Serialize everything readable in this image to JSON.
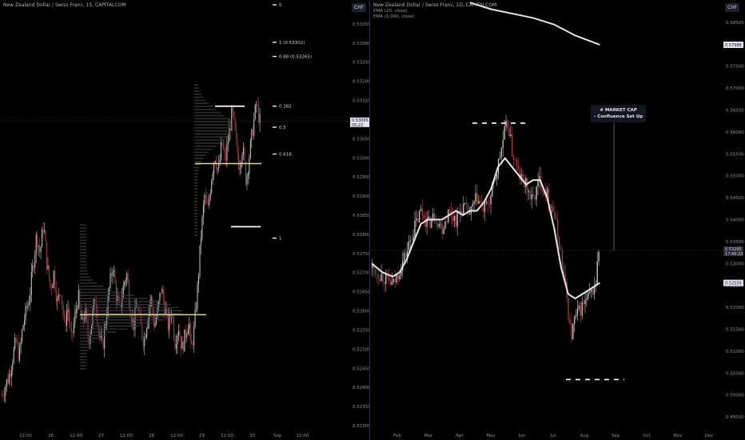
{
  "left": {
    "title": "New Zealand Dollar / Swiss Franc, 15, CAPITALCOM",
    "currency_button": "CHF",
    "price_tag": "0.53095",
    "price_tag_sub": "05:22",
    "fib_levels": [
      {
        "label": "0",
        "value": 0.534
      },
      {
        "label": "1 (0.53302)",
        "value": 0.53302
      },
      {
        "label": "0.88 (0.53265)",
        "value": 0.53265
      },
      {
        "label": "0.382",
        "value": 0.53135
      },
      {
        "label": "0.5",
        "value": 0.5308
      },
      {
        "label": "0.618",
        "value": 0.5301
      },
      {
        "label": "1",
        "value": 0.5279
      }
    ],
    "chart_data": {
      "type": "candlestick",
      "xlabel": "",
      "ylabel": "",
      "ylim": [
        0.523,
        0.534
      ],
      "y_ticks": [
        "0.53350",
        "0.53300",
        "0.53250",
        "0.53200",
        "0.53150",
        "0.53100",
        "0.53050",
        "0.53000",
        "0.52950",
        "0.52900",
        "0.52850",
        "0.52800",
        "0.52750",
        "0.52700",
        "0.52650",
        "0.52600",
        "0.52550",
        "0.52500",
        "0.52450",
        "0.52400",
        "0.52350",
        "0.52300"
      ],
      "x_ticks": [
        "12:00",
        "26",
        "12:00",
        "27",
        "12:00",
        "28",
        "12:00",
        "29",
        "12:00",
        "30",
        "Sep",
        "12:00"
      ],
      "last_price": 0.53095,
      "close_path": [
        [
          0.0,
          0.5238
        ],
        [
          0.02,
          0.5243
        ],
        [
          0.04,
          0.5252
        ],
        [
          0.05,
          0.5248
        ],
        [
          0.06,
          0.5256
        ],
        [
          0.08,
          0.5264
        ],
        [
          0.09,
          0.5272
        ],
        [
          0.1,
          0.528
        ],
        [
          0.11,
          0.5275
        ],
        [
          0.12,
          0.5283
        ],
        [
          0.13,
          0.5272
        ],
        [
          0.14,
          0.5266
        ],
        [
          0.15,
          0.527
        ],
        [
          0.16,
          0.5262
        ],
        [
          0.17,
          0.5266
        ],
        [
          0.18,
          0.5256
        ],
        [
          0.19,
          0.5261
        ],
        [
          0.2,
          0.5252
        ],
        [
          0.21,
          0.5258
        ],
        [
          0.22,
          0.5264
        ],
        [
          0.23,
          0.5256
        ],
        [
          0.24,
          0.526
        ],
        [
          0.25,
          0.5252
        ],
        [
          0.26,
          0.5258
        ],
        [
          0.27,
          0.5264
        ],
        [
          0.28,
          0.5254
        ],
        [
          0.29,
          0.525
        ],
        [
          0.3,
          0.5258
        ],
        [
          0.31,
          0.5266
        ],
        [
          0.32,
          0.5272
        ],
        [
          0.33,
          0.5264
        ],
        [
          0.34,
          0.526
        ],
        [
          0.35,
          0.5266
        ],
        [
          0.36,
          0.527
        ],
        [
          0.37,
          0.5261
        ],
        [
          0.38,
          0.5256
        ],
        [
          0.39,
          0.5262
        ],
        [
          0.4,
          0.5256
        ],
        [
          0.41,
          0.5252
        ],
        [
          0.42,
          0.5258
        ],
        [
          0.43,
          0.5264
        ],
        [
          0.44,
          0.5256
        ],
        [
          0.45,
          0.526
        ],
        [
          0.46,
          0.5266
        ],
        [
          0.47,
          0.5261
        ],
        [
          0.48,
          0.5256
        ],
        [
          0.49,
          0.526
        ],
        [
          0.5,
          0.5252
        ],
        [
          0.51,
          0.5256
        ],
        [
          0.52,
          0.525
        ],
        [
          0.53,
          0.5254
        ],
        [
          0.54,
          0.5258
        ],
        [
          0.545,
          0.5249
        ],
        [
          0.555,
          0.5255
        ],
        [
          0.565,
          0.5266
        ],
        [
          0.575,
          0.528
        ],
        [
          0.585,
          0.529
        ],
        [
          0.595,
          0.5286
        ],
        [
          0.605,
          0.5295
        ],
        [
          0.615,
          0.5301
        ],
        [
          0.625,
          0.5296
        ],
        [
          0.635,
          0.5304
        ],
        [
          0.645,
          0.5299
        ],
        [
          0.655,
          0.5306
        ],
        [
          0.665,
          0.5312
        ],
        [
          0.675,
          0.5305
        ],
        [
          0.685,
          0.5298
        ],
        [
          0.695,
          0.5303
        ],
        [
          0.705,
          0.5294
        ],
        [
          0.715,
          0.5301
        ],
        [
          0.725,
          0.5308
        ],
        [
          0.735,
          0.5314
        ],
        [
          0.745,
          0.53095
        ]
      ],
      "annotations": [
        {
          "text": "horizontal level",
          "y": 0.52985
        },
        {
          "text": "horizontal level",
          "y": 0.5259
        }
      ]
    }
  },
  "right": {
    "title": "New Zealand Dollar / Swiss Franc, 1D, CAPITALCOM",
    "legend": [
      "EMA (20, close)",
      "EMA (1,000, close)"
    ],
    "currency_button": "CHF",
    "price_tag": "0.53295",
    "price_tag_sub": "17:45:23",
    "ema_tag": "0.52555",
    "ema_long_tag": "0.57988",
    "annotation_title": "# MARKET CAP",
    "annotation_sub": "- Confluence Set Up",
    "chart_data": {
      "type": "candlestick",
      "xlabel": "",
      "ylabel": "",
      "ylim": [
        0.493,
        0.589
      ],
      "y_ticks": [
        "0.58500",
        "0.58000",
        "0.57500",
        "0.57000",
        "0.56500",
        "0.56000",
        "0.55500",
        "0.55000",
        "0.54500",
        "0.54000",
        "0.53500",
        "0.53000",
        "0.52500",
        "0.52000",
        "0.51500",
        "0.51000",
        "0.50500",
        "0.50000",
        "0.49500"
      ],
      "x_ticks": [
        "Feb",
        "Mar",
        "Apr",
        "May",
        "Jun",
        "Jul",
        "Aug",
        "Sep",
        "Oct",
        "Nov",
        "Dec"
      ],
      "last_price": 0.53295,
      "close_path": [
        [
          0.0,
          0.529
        ],
        [
          0.03,
          0.527
        ],
        [
          0.06,
          0.525
        ],
        [
          0.08,
          0.529
        ],
        [
          0.1,
          0.533
        ],
        [
          0.12,
          0.538
        ],
        [
          0.14,
          0.542
        ],
        [
          0.16,
          0.539
        ],
        [
          0.18,
          0.541
        ],
        [
          0.2,
          0.538
        ],
        [
          0.22,
          0.542
        ],
        [
          0.24,
          0.54
        ],
        [
          0.26,
          0.543
        ],
        [
          0.28,
          0.541
        ],
        [
          0.3,
          0.545
        ],
        [
          0.32,
          0.542
        ],
        [
          0.34,
          0.545
        ],
        [
          0.36,
          0.552
        ],
        [
          0.38,
          0.56
        ],
        [
          0.39,
          0.562
        ],
        [
          0.4,
          0.556
        ],
        [
          0.42,
          0.55
        ],
        [
          0.44,
          0.548
        ],
        [
          0.46,
          0.544
        ],
        [
          0.48,
          0.549
        ],
        [
          0.5,
          0.546
        ],
        [
          0.52,
          0.542
        ],
        [
          0.54,
          0.533
        ],
        [
          0.56,
          0.521
        ],
        [
          0.57,
          0.513
        ],
        [
          0.58,
          0.517
        ],
        [
          0.6,
          0.52
        ],
        [
          0.62,
          0.522
        ],
        [
          0.64,
          0.525
        ],
        [
          0.65,
          0.53295
        ]
      ],
      "ema20_path": [
        [
          0.0,
          0.53
        ],
        [
          0.03,
          0.528
        ],
        [
          0.06,
          0.527
        ],
        [
          0.08,
          0.528
        ],
        [
          0.1,
          0.531
        ],
        [
          0.12,
          0.535
        ],
        [
          0.14,
          0.539
        ],
        [
          0.16,
          0.54
        ],
        [
          0.18,
          0.54
        ],
        [
          0.2,
          0.54
        ],
        [
          0.22,
          0.541
        ],
        [
          0.24,
          0.542
        ],
        [
          0.26,
          0.541
        ],
        [
          0.28,
          0.542
        ],
        [
          0.3,
          0.542
        ],
        [
          0.32,
          0.544
        ],
        [
          0.34,
          0.547
        ],
        [
          0.36,
          0.552
        ],
        [
          0.38,
          0.554
        ],
        [
          0.39,
          0.553
        ],
        [
          0.4,
          0.552
        ],
        [
          0.42,
          0.55
        ],
        [
          0.44,
          0.548
        ],
        [
          0.46,
          0.549
        ],
        [
          0.48,
          0.549
        ],
        [
          0.5,
          0.545
        ],
        [
          0.52,
          0.538
        ],
        [
          0.54,
          0.529
        ],
        [
          0.56,
          0.523
        ],
        [
          0.58,
          0.522
        ],
        [
          0.6,
          0.523
        ],
        [
          0.62,
          0.524
        ],
        [
          0.65,
          0.52555
        ]
      ],
      "ema1000_path": [
        [
          0.28,
          0.5895
        ],
        [
          0.34,
          0.588
        ],
        [
          0.4,
          0.587
        ],
        [
          0.46,
          0.586
        ],
        [
          0.52,
          0.5845
        ],
        [
          0.58,
          0.582
        ],
        [
          0.65,
          0.57988
        ]
      ],
      "levels": [
        {
          "name": "top dashed",
          "y": 0.562
        },
        {
          "name": "bottom dashed",
          "y": 0.5035
        },
        {
          "name": "current price line",
          "y": 0.53295
        }
      ]
    }
  }
}
